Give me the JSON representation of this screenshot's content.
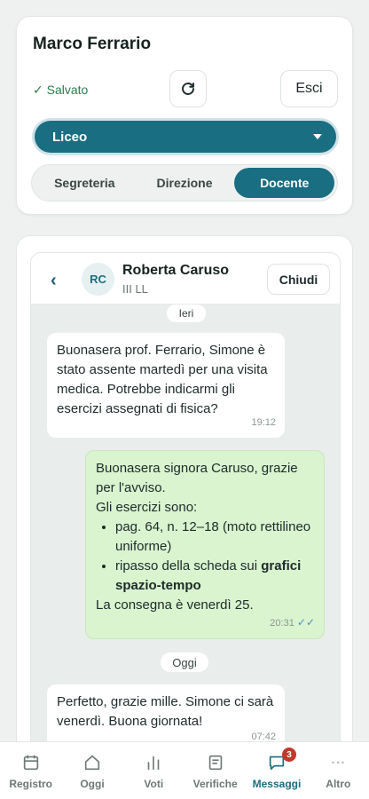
{
  "header": {
    "user_name": "Marco Ferrario",
    "status_text": "✓ Salvato",
    "refresh_icon": "refresh-icon",
    "logout_label": "Esci",
    "school_select": "Liceo",
    "segments": [
      {
        "label": "Segreteria",
        "active": false
      },
      {
        "label": "Direzione",
        "active": false
      },
      {
        "label": "Docente",
        "active": true
      }
    ]
  },
  "chat": {
    "back_icon": "chevron-left-icon",
    "avatar_initials": "RC",
    "contact_name": "Roberta Caruso",
    "contact_class": "III LL",
    "close_label": "Chiudi",
    "day_yesterday": "Ieri",
    "day_today": "Oggi",
    "messages": [
      {
        "direction": "in",
        "text": "Buonasera prof. Ferrario, Simone è stato assente martedì per una visita medica. Potrebbe indicarmi gli esercizi assegnati di fisica?",
        "time": "19:12"
      },
      {
        "direction": "out",
        "intro": "Buonasera signora Caruso, grazie per l'avviso.",
        "list_intro": "Gli esercizi sono:",
        "item_1": "pag. 64, n. 12–18 (moto rettilineo uniforme)",
        "item_2_prefix": "ripasso della scheda sui ",
        "item_2_bold": "grafici spazio-tempo",
        "closing": "La consegna è venerdì 25.",
        "time": "20:31",
        "read_icon": "double-check-icon"
      },
      {
        "direction": "in",
        "text": "Perfetto, grazie mille. Simone ci sarà venerdì. Buona giornata!",
        "time": "07:42"
      }
    ]
  },
  "nav": {
    "items": [
      {
        "label": "Registro",
        "icon": "calendar-icon",
        "active": false
      },
      {
        "label": "Oggi",
        "icon": "home-icon",
        "active": false
      },
      {
        "label": "Voti",
        "icon": "bars-icon",
        "active": false
      },
      {
        "label": "Verifiche",
        "icon": "document-icon",
        "active": false
      },
      {
        "label": "Messaggi",
        "icon": "chat-icon",
        "active": true,
        "badge": "3"
      },
      {
        "label": "Altro",
        "icon": "more-icon",
        "active": false
      }
    ]
  },
  "colors": {
    "accent": "#1a6e82",
    "status_green": "#2d7d4d",
    "outgoing_bubble": "#daf4cf",
    "badge": "#c0392b"
  }
}
